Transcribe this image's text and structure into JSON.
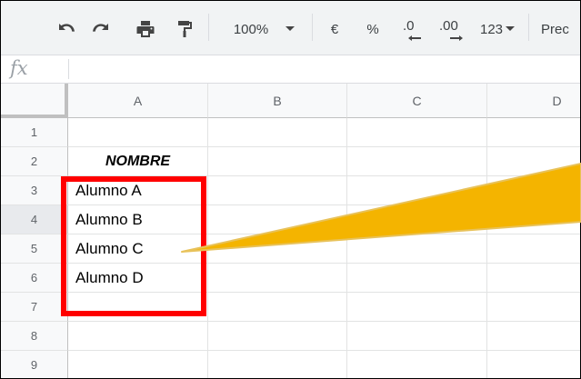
{
  "toolbar": {
    "zoom": "100%",
    "currency": "€",
    "percent": "%",
    "decimal_decrease": ".0",
    "decimal_increase": ".00",
    "more_formats": "123",
    "truncated_label": "Prec"
  },
  "formula_bar": {
    "fx": "fx",
    "value": ""
  },
  "columns": [
    "A",
    "B",
    "C",
    "D"
  ],
  "rows": [
    "1",
    "2",
    "3",
    "4",
    "5",
    "6",
    "7",
    "8",
    "9"
  ],
  "cells": {
    "A2": "NOMBRE",
    "A3": "Alumno A",
    "A4": "Alumno B",
    "A5": "Alumno C",
    "A6": "Alumno D"
  },
  "colors": {
    "highlight_box": "#ff0000",
    "arrow": "#f4b400",
    "arrow_border": "#e8c25a"
  }
}
